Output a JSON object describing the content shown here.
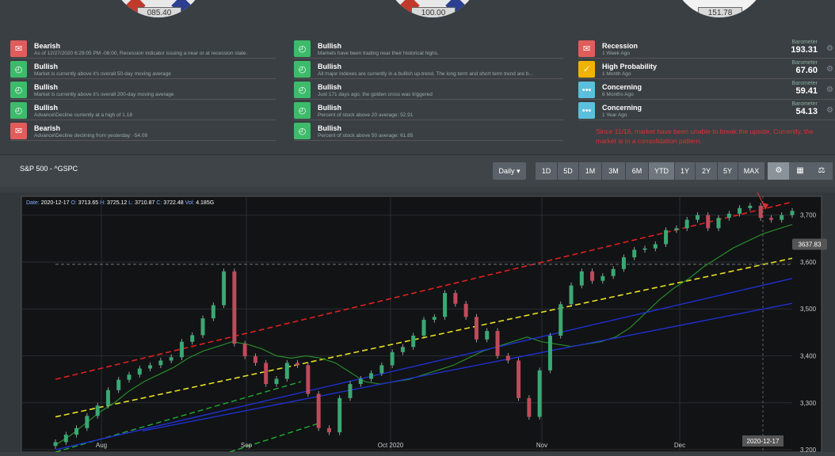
{
  "gauges": [
    {
      "value": "085.40"
    },
    {
      "value": "100.00"
    },
    {
      "value": "151.78"
    }
  ],
  "alerts_left": [
    {
      "kind": "bear",
      "title": "Bearish",
      "sub": "As of 12/27/2020 6:29:05 PM -06:00, Recession indicator issuing a near or at recession state."
    },
    {
      "kind": "bull",
      "title": "Bullish",
      "sub": "Market is currently above it's overall 50-day moving average"
    },
    {
      "kind": "bull",
      "title": "Bullish",
      "sub": "Market is currently above it's overall 200-day moving average"
    },
    {
      "kind": "bull",
      "title": "Bullish",
      "sub": "Advance\\Decline currently at a high of 1.18"
    },
    {
      "kind": "bear",
      "title": "Bearish",
      "sub": "Advance\\Decline declining from yesterday: -54.09"
    }
  ],
  "alerts_mid": [
    {
      "kind": "bull",
      "title": "Bullish",
      "sub": "Markets have been trading near their historical highs."
    },
    {
      "kind": "bull",
      "title": "Bullish",
      "sub": "All major indexes are currently in a bullish up-trend. The long term and short term trend are b..."
    },
    {
      "kind": "bull",
      "title": "Bullish",
      "sub": "Just 171 days ago, the golden cross was triggered"
    },
    {
      "kind": "bull",
      "title": "Bullish",
      "sub": "Percent of stock above 20 average: 52.91"
    },
    {
      "kind": "bull",
      "title": "Bullish",
      "sub": "Percent of stock above 50 average: 61.85"
    }
  ],
  "alerts_right": [
    {
      "kind": "bear",
      "title": "Recession",
      "sub": "1 Week Ago",
      "baro_label": "Barometer",
      "baro_value": "193.31"
    },
    {
      "kind": "warn",
      "title": "High Probability",
      "sub": "1 Month Ago",
      "baro_label": "Barometer",
      "baro_value": "67.60"
    },
    {
      "kind": "info",
      "title": "Concerning",
      "sub": "6 Months Ago",
      "baro_label": "Barometer",
      "baro_value": "59.41"
    },
    {
      "kind": "info",
      "title": "Concerning",
      "sub": "1 Year Ago",
      "baro_label": "Barometer",
      "baro_value": "54.13"
    }
  ],
  "annotation": "Since 11/18, market have been unable to break the upside. Currently, the market is in a consolidation pattern.",
  "panel": {
    "title": "S&P 500 - ^GSPC",
    "interval": "Daily",
    "ranges": [
      "1D",
      "5D",
      "1M",
      "3M",
      "6M",
      "YTD",
      "1Y",
      "2Y",
      "5Y",
      "MAX"
    ],
    "active_range": "YTD"
  },
  "ohlc_readout": {
    "date_label": "Date:",
    "date": "2020-12-17",
    "o_label": "O:",
    "o": "3713.65",
    "h_label": "H:",
    "h": "3725.12",
    "l_label": "L:",
    "l": "3710.87",
    "c_label": "C:",
    "c": "3722.48",
    "vol_label": "Vol:",
    "vol": "4.185G"
  },
  "chart_data": {
    "type": "line",
    "x_ticks": [
      "Aug",
      "Sep",
      "Oct 2020",
      "Nov",
      "Dec"
    ],
    "y_ticks": [
      3200,
      3300,
      3400,
      3500,
      3600,
      3700
    ],
    "y_tick_labels": [
      "3,200",
      "3,300",
      "3,400",
      "3,500",
      "3,600",
      "3,700"
    ],
    "ylim": [
      3195,
      3740
    ],
    "price_marker": "3637.83",
    "crosshair_date": "2020-12-17",
    "series": [
      {
        "values": [
          3216,
          3232,
          3246,
          3272,
          3294,
          3327,
          3349,
          3360,
          3373,
          3380,
          3390,
          3397,
          3430,
          3444,
          3480,
          3508,
          3580,
          3426,
          3399,
          3385,
          3340,
          3351,
          3385,
          3380,
          3319,
          3246,
          3237,
          3310,
          3340,
          3351,
          3363,
          3380,
          3408,
          3419,
          3443,
          3477,
          3483,
          3534,
          3511,
          3483,
          3435,
          3453,
          3400,
          3390,
          3310,
          3270,
          3369,
          3443,
          3510,
          3550,
          3580,
          3560,
          3570,
          3585,
          3610,
          3626,
          3629,
          3638,
          3668,
          3672,
          3690,
          3700,
          3672,
          3694,
          3703,
          3715,
          3720,
          3694,
          3690,
          3700,
          3709
        ]
      },
      {
        "values": [
          3210,
          3230,
          3255,
          3280,
          3300,
          3325,
          3345,
          3360,
          3375,
          3395,
          3410,
          3420,
          3430,
          3425,
          3415,
          3400,
          3395,
          3400,
          3395,
          3385,
          3365,
          3345,
          3340,
          3345,
          3350,
          3360,
          3370,
          3380,
          3395,
          3410,
          3420,
          3430,
          3440,
          3430,
          3425,
          3420,
          3425,
          3430,
          3440,
          3460,
          3490,
          3520,
          3545,
          3565,
          3590,
          3610,
          3630,
          3645,
          3660,
          3670,
          3680
        ]
      }
    ]
  },
  "toolbar_icons": [
    "settings-icon",
    "calculator-icon",
    "scale-icon"
  ]
}
